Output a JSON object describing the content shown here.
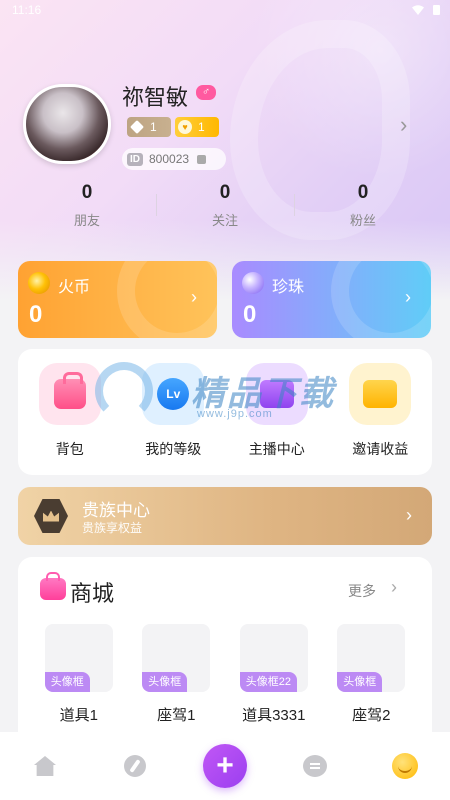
{
  "status_bar": {
    "time": "11:16"
  },
  "profile": {
    "name": "祢智敏",
    "gender_symbol": "♂",
    "wealth_level": "1",
    "charm_level": "1",
    "id_label": "ID",
    "id_value": "800023",
    "arrow": "›"
  },
  "stats": [
    {
      "value": "0",
      "label": "朋友"
    },
    {
      "value": "0",
      "label": "关注"
    },
    {
      "value": "0",
      "label": "粉丝"
    }
  ],
  "currencies": [
    {
      "name": "火币",
      "value": "0",
      "icon": "coin-icon"
    },
    {
      "name": "珍珠",
      "value": "0",
      "icon": "pearl-icon"
    }
  ],
  "functions": [
    {
      "label": "背包",
      "icon": "backpack-icon"
    },
    {
      "label": "我的等级",
      "icon": "level-icon",
      "icon_text": "Lv"
    },
    {
      "label": "主播中心",
      "icon": "host-icon"
    },
    {
      "label": "邀请收益",
      "icon": "wallet-icon"
    }
  ],
  "noble": {
    "title": "贵族中心",
    "subtitle": "贵族享权益",
    "icon": "crown-icon"
  },
  "shop": {
    "title": "商城",
    "more_label": "更多",
    "items": [
      {
        "tag": "头像框",
        "name": "道具1"
      },
      {
        "tag": "头像框",
        "name": "座驾1"
      },
      {
        "tag": "头像框22",
        "name": "道具3331"
      },
      {
        "tag": "头像框",
        "name": "座驾2"
      }
    ]
  },
  "bottom_nav": [
    {
      "icon": "home-icon"
    },
    {
      "icon": "discover-icon"
    },
    {
      "icon": "plus-icon",
      "symbol": "+"
    },
    {
      "icon": "message-icon"
    },
    {
      "icon": "me-icon"
    }
  ],
  "watermark": {
    "text": "精品下载",
    "url": "www.j9p.com"
  }
}
